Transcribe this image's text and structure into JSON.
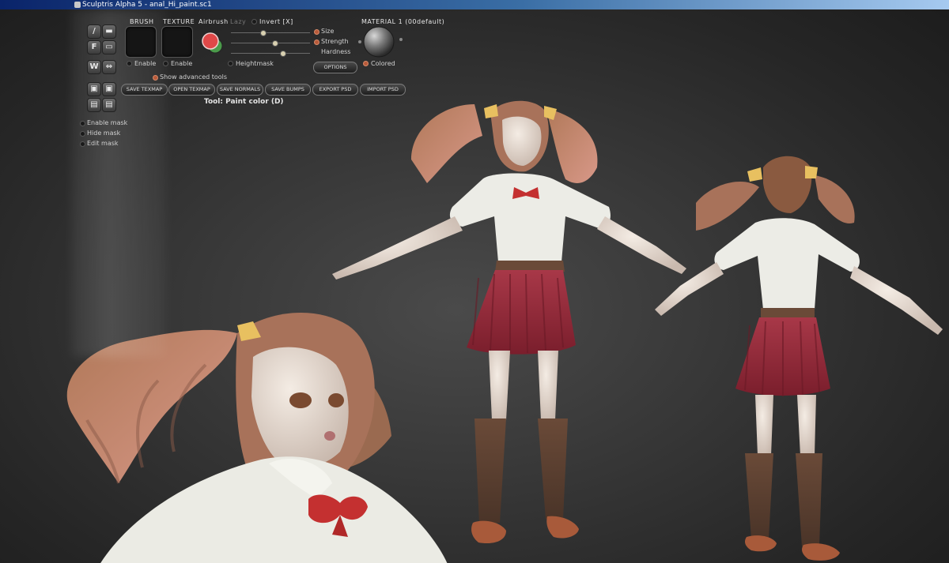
{
  "window": {
    "title": "Sculptris Alpha 5 - anal_Hi_paint.sc1"
  },
  "tool_buttons": {
    "draw": "/",
    "flatten": "F",
    "crease": "W",
    "pinch": "⇔"
  },
  "panel": {
    "brush_header": "BRUSH",
    "texture_header": "TEXTURE",
    "airbrush_label": "Airbrush",
    "lazy_label": "Lazy",
    "invert_label": "Invert [X]",
    "size_label": "Size",
    "strength_label": "Strength",
    "hardness_label": "Hardness",
    "material_header": "MATERIAL 1 (00default)",
    "brush_enable_label": "Enable",
    "texture_enable_label": "Enable",
    "heightmask_label": "Heightmask",
    "options_button": "OPTIONS",
    "colored_label": "Colored",
    "advanced_label": "Show advanced tools",
    "paint_color_primary": "#e04848",
    "paint_color_secondary": "#4a9a4a"
  },
  "buttons": {
    "save_texmap": "SAVE TEXMAP",
    "open_texmap": "OPEN TEXMAP",
    "save_normals": "SAVE NORMALS",
    "save_bumps": "SAVE BUMPS",
    "export_psd": "EXPORT PSD",
    "import_psd": "IMPORT PSD"
  },
  "tool_status": "Tool: Paint color (D)",
  "mask": {
    "enable_mask": "Enable mask",
    "hide_mask": "Hide mask",
    "edit_mask": "Edit mask"
  },
  "sliders": {
    "size": 0.4,
    "strength": 0.55,
    "hardness": 0.65
  }
}
